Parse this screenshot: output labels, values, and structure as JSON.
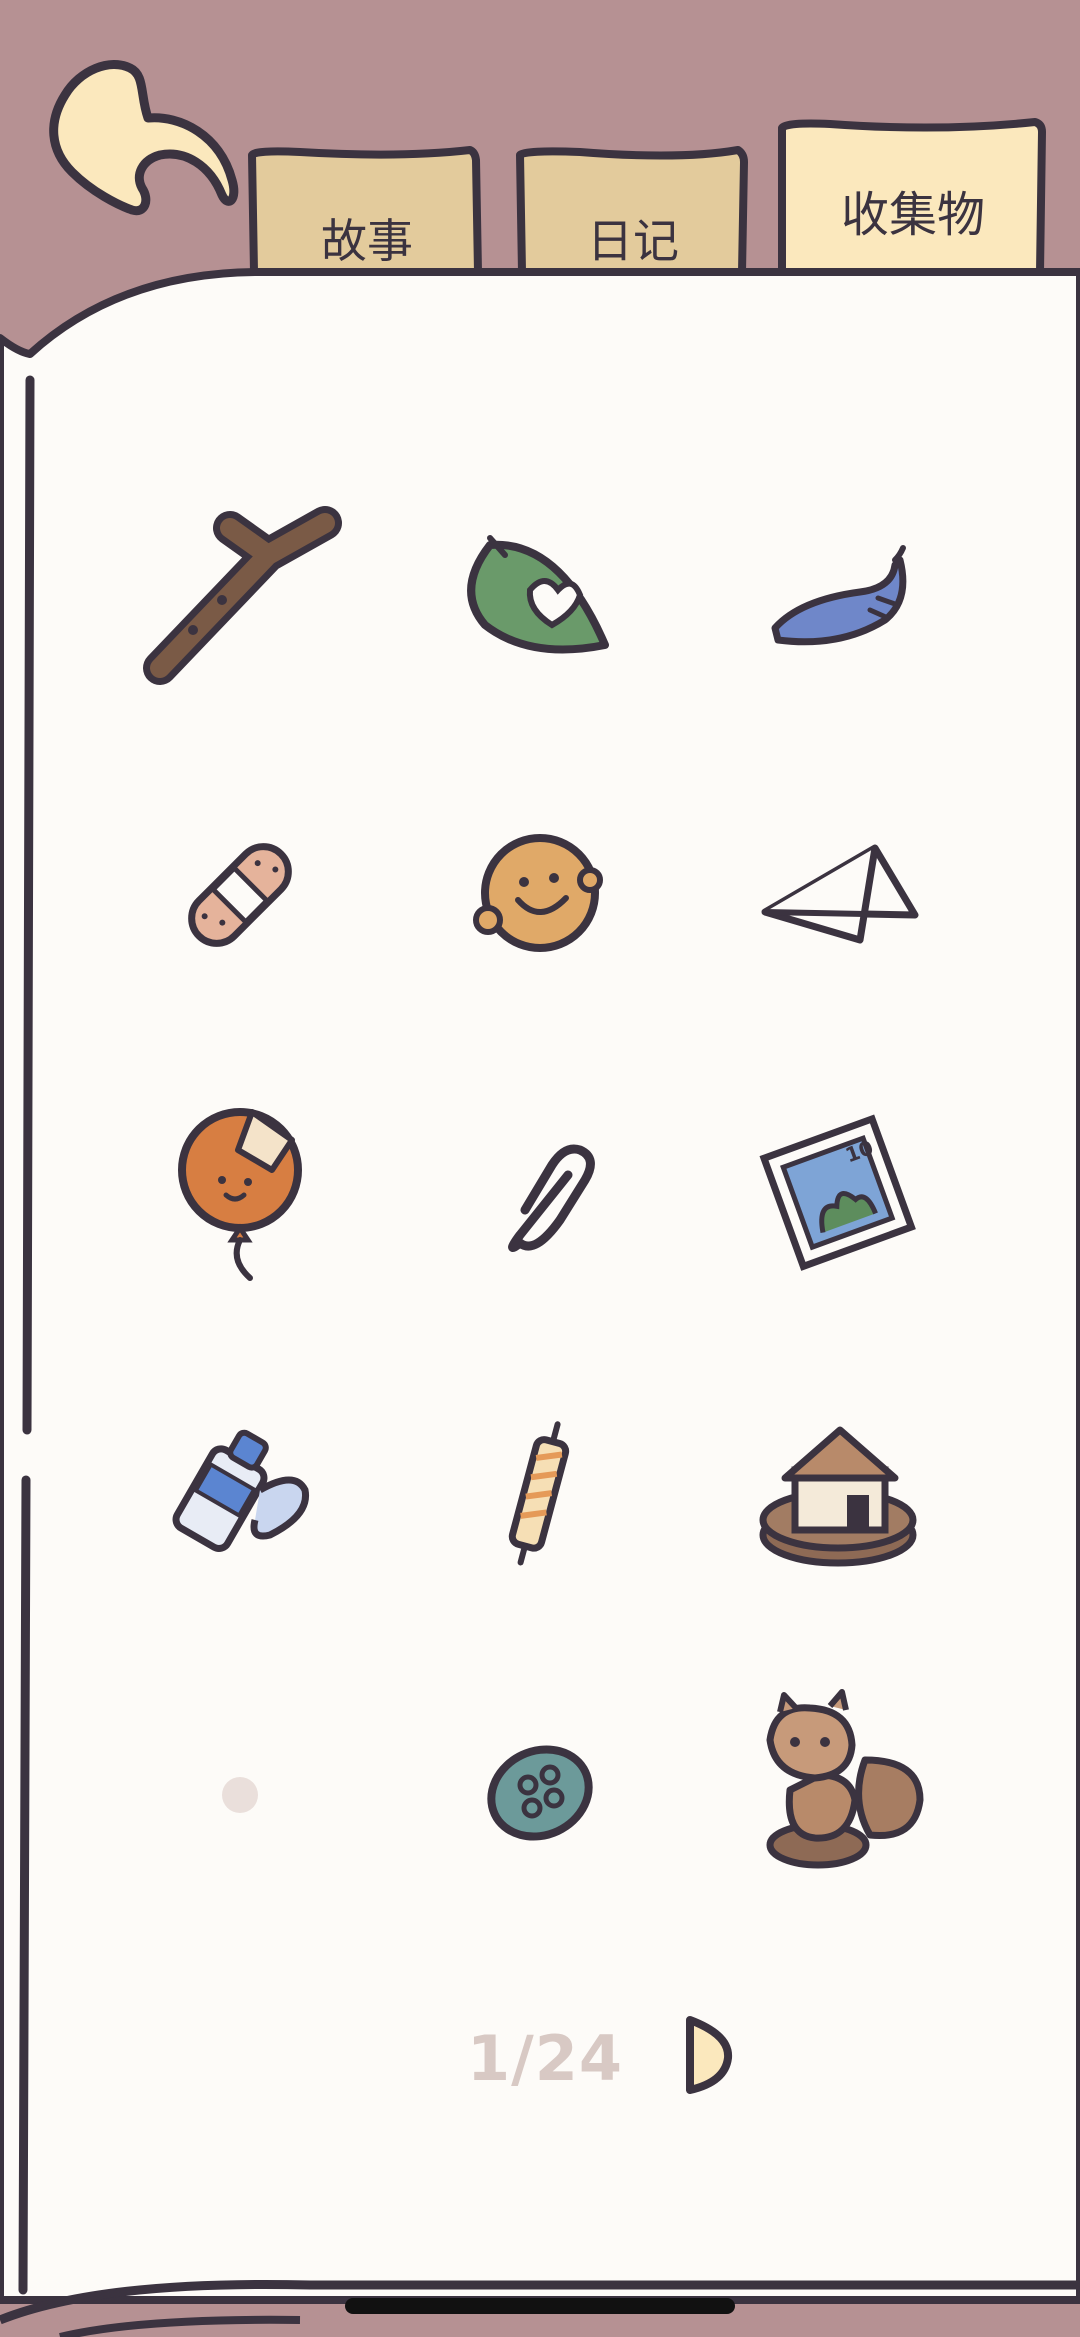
{
  "tabs": [
    {
      "label": "故事"
    },
    {
      "label": "日记"
    },
    {
      "label": "收集物",
      "active": true
    }
  ],
  "colors": {
    "header_bg": "#b69193",
    "page_bg": "#fdfbf8",
    "tab_bg": "#e3cb9c",
    "tab_active_bg": "#fbe8bd",
    "outline": "#3b3340",
    "pager_text": "#d8c9c4",
    "back_arrow": "#fbe8bd"
  },
  "collection_grid": [
    {
      "icon": "twig-icon"
    },
    {
      "icon": "heart-leaf-icon"
    },
    {
      "icon": "blue-feather-icon"
    },
    {
      "icon": "bandage-icon"
    },
    {
      "icon": "smiley-coin-icon"
    },
    {
      "icon": "paper-plane-icon"
    },
    {
      "icon": "patched-balloon-icon"
    },
    {
      "icon": "paperclip-icon"
    },
    {
      "icon": "postage-stamp-icon"
    },
    {
      "icon": "glue-bottle-icon"
    },
    {
      "icon": "striped-candle-icon"
    },
    {
      "icon": "house-figurine-icon"
    },
    {
      "icon": "empty-slot-dot-icon"
    },
    {
      "icon": "button-icon"
    },
    {
      "icon": "squirrel-figurine-icon"
    }
  ],
  "pager": {
    "label": "1/24"
  }
}
